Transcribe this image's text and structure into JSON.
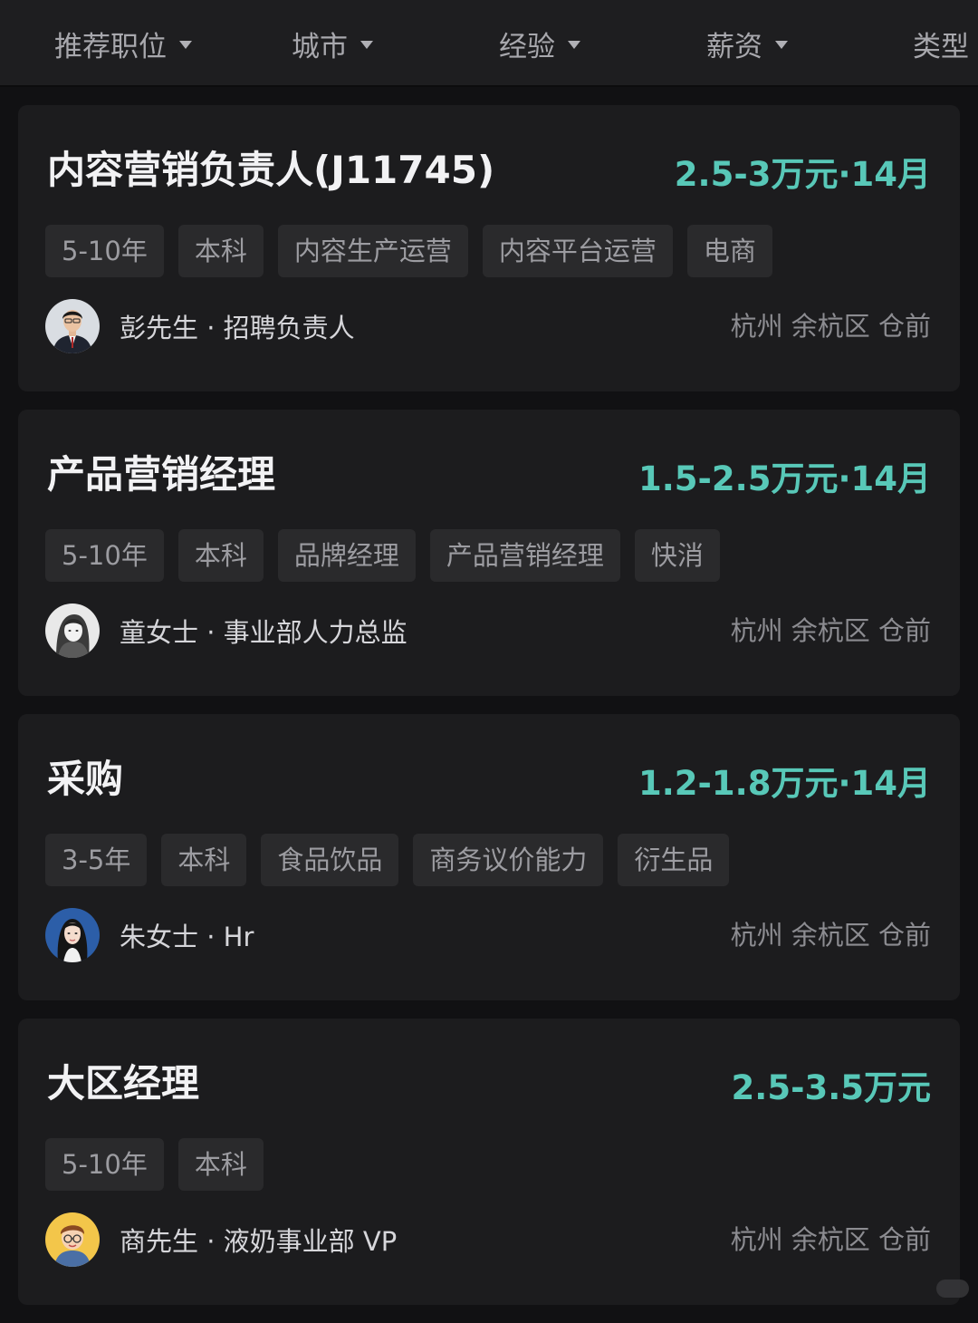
{
  "filters": [
    {
      "label": "推荐职位"
    },
    {
      "label": "城市"
    },
    {
      "label": "经验"
    },
    {
      "label": "薪资"
    },
    {
      "label": "类型"
    }
  ],
  "jobs": [
    {
      "title": "内容营销负责人(J11745)",
      "salary": "2.5-3万元·14月",
      "tags": [
        "5-10年",
        "本科",
        "内容生产运营",
        "内容平台运营",
        "电商"
      ],
      "recruiter": "彭先生 · 招聘负责人",
      "location": "杭州 余杭区 仓前",
      "avatar_icon": "man-in-suit-avatar"
    },
    {
      "title": "产品营销经理",
      "salary": "1.5-2.5万元·14月",
      "tags": [
        "5-10年",
        "本科",
        "品牌经理",
        "产品营销经理",
        "快消"
      ],
      "recruiter": "童女士 · 事业部人力总监",
      "location": "杭州 余杭区 仓前",
      "avatar_icon": "woman-portrait-avatar"
    },
    {
      "title": "采购",
      "salary": "1.2-1.8万元·14月",
      "tags": [
        "3-5年",
        "本科",
        "食品饮品",
        "商务议价能力",
        "衍生品"
      ],
      "recruiter": "朱女士 · Hr",
      "location": "杭州 余杭区 仓前",
      "avatar_icon": "woman-photo-avatar"
    },
    {
      "title": "大区经理",
      "salary": "2.5-3.5万元",
      "tags": [
        "5-10年",
        "本科"
      ],
      "recruiter": "商先生 · 液奶事业部 VP",
      "location": "杭州 余杭区 仓前",
      "avatar_icon": "cartoon-man-avatar"
    }
  ],
  "colors": {
    "background": "#111113",
    "card": "#1c1c1e",
    "tag_bg": "#2a2a2c",
    "salary": "#58c8b8"
  }
}
